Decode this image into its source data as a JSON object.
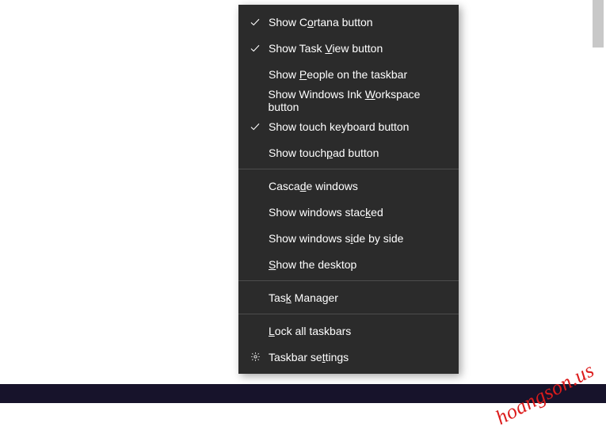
{
  "menu_labels": {
    "show_cortana": "Show C<u>o</u>rtana button",
    "show_task_view": "Show Task <u>V</u>iew button",
    "show_people": "Show <u>P</u>eople on the taskbar",
    "show_ink": "Show Windows Ink <u>W</u>orkspace button",
    "show_touch_kb": "Show touch keyboard button",
    "show_touchpad": "Show touch<u>p</u>ad button",
    "cascade": "Casca<u>d</u>e windows",
    "stacked": "Show windows stac<u>k</u>ed",
    "side_by_side": "Show windows s<u>i</u>de by side",
    "show_desktop": "<u>S</u>how the desktop",
    "task_manager": "Tas<u>k</u> Manager",
    "lock_taskbars": "<u>L</u>ock all taskbars",
    "taskbar_settings": "Taskbar se<u>t</u>tings"
  },
  "watermark": "hoangson.us"
}
